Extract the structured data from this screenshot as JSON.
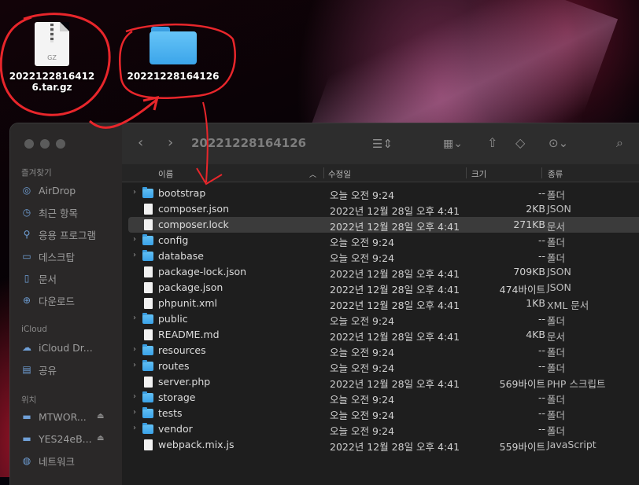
{
  "desktop": {
    "archive_label": "20221228164126.tar.gz",
    "archive_badge": "GZ",
    "folder_label": "20221228164126"
  },
  "window": {
    "title": "20221228164126",
    "nav_back_icon": "chevron-left-icon",
    "nav_forward_icon": "chevron-right-icon"
  },
  "sidebar": {
    "favorites_header": "즐겨찾기",
    "favorites": [
      {
        "label": "AirDrop",
        "icon": "airdrop-icon"
      },
      {
        "label": "최근 항목",
        "icon": "clock-icon"
      },
      {
        "label": "응용 프로그램",
        "icon": "apps-icon"
      },
      {
        "label": "데스크탑",
        "icon": "desktop-icon"
      },
      {
        "label": "문서",
        "icon": "document-icon"
      },
      {
        "label": "다운로드",
        "icon": "download-icon"
      }
    ],
    "icloud_header": "iCloud",
    "icloud": [
      {
        "label": "iCloud Dr...",
        "icon": "cloud-icon"
      },
      {
        "label": "공유",
        "icon": "shared-folder-icon"
      }
    ],
    "locations_header": "위치",
    "locations": [
      {
        "label": "MTWOR...",
        "icon": "disk-icon"
      },
      {
        "label": "YES24eB...",
        "icon": "disk-icon"
      },
      {
        "label": "네트워크",
        "icon": "network-icon"
      }
    ]
  },
  "columns": {
    "name": "이름",
    "modified": "수정일",
    "size": "크기",
    "kind": "종류"
  },
  "files": [
    {
      "name": "bootstrap",
      "type": "folder",
      "date": "오늘 오전 9:24",
      "size": "--",
      "kind": "폴더"
    },
    {
      "name": "composer.json",
      "type": "doc",
      "date": "2022년 12월 28일 오후 4:41",
      "size": "2KB",
      "kind": "JSON"
    },
    {
      "name": "composer.lock",
      "type": "doc",
      "date": "2022년 12월 28일 오후 4:41",
      "size": "271KB",
      "kind": "문서"
    },
    {
      "name": "config",
      "type": "folder",
      "date": "오늘 오전 9:24",
      "size": "--",
      "kind": "폴더"
    },
    {
      "name": "database",
      "type": "folder",
      "date": "오늘 오전 9:24",
      "size": "--",
      "kind": "폴더"
    },
    {
      "name": "package-lock.json",
      "type": "doc",
      "date": "2022년 12월 28일 오후 4:41",
      "size": "709KB",
      "kind": "JSON"
    },
    {
      "name": "package.json",
      "type": "doc",
      "date": "2022년 12월 28일 오후 4:41",
      "size": "474바이트",
      "kind": "JSON"
    },
    {
      "name": "phpunit.xml",
      "type": "doc",
      "date": "2022년 12월 28일 오후 4:41",
      "size": "1KB",
      "kind": "XML 문서"
    },
    {
      "name": "public",
      "type": "folder",
      "date": "오늘 오전 9:24",
      "size": "--",
      "kind": "폴더"
    },
    {
      "name": "README.md",
      "type": "doc",
      "date": "2022년 12월 28일 오후 4:41",
      "size": "4KB",
      "kind": "문서"
    },
    {
      "name": "resources",
      "type": "folder",
      "date": "오늘 오전 9:24",
      "size": "--",
      "kind": "폴더"
    },
    {
      "name": "routes",
      "type": "folder",
      "date": "오늘 오전 9:24",
      "size": "--",
      "kind": "폴더"
    },
    {
      "name": "server.php",
      "type": "doc",
      "date": "2022년 12월 28일 오후 4:41",
      "size": "569바이트",
      "kind": "PHP 스크립트"
    },
    {
      "name": "storage",
      "type": "folder",
      "date": "오늘 오전 9:24",
      "size": "--",
      "kind": "폴더"
    },
    {
      "name": "tests",
      "type": "folder",
      "date": "오늘 오전 9:24",
      "size": "--",
      "kind": "폴더"
    },
    {
      "name": "vendor",
      "type": "folder",
      "date": "오늘 오전 9:24",
      "size": "--",
      "kind": "폴더"
    },
    {
      "name": "webpack.mix.js",
      "type": "doc",
      "date": "2022년 12월 28일 오후 4:41",
      "size": "559바이트",
      "kind": "JavaScript"
    }
  ],
  "selected_file": "composer.lock",
  "annotation_color": "#e8262b"
}
